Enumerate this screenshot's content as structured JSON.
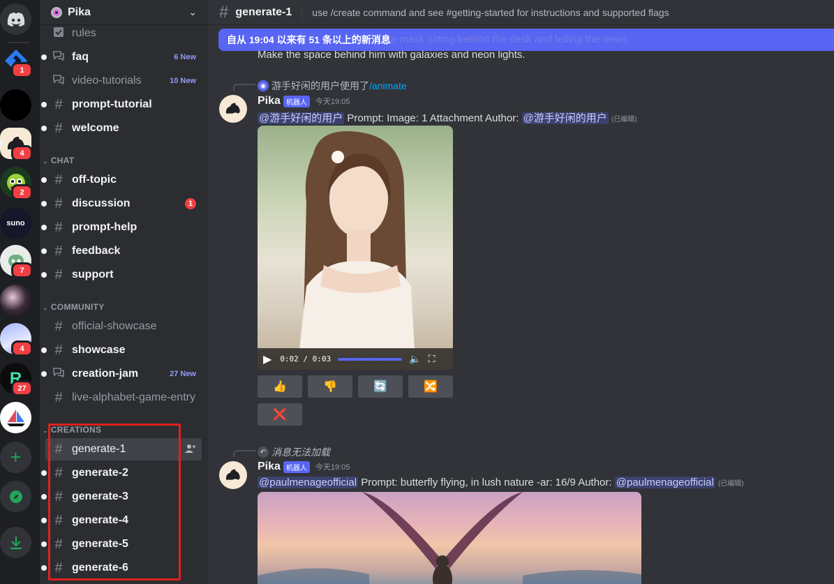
{
  "rail": {
    "servers": [
      {
        "name": "discord-home",
        "badge": ""
      },
      {
        "name": "server-blue",
        "badge": "1"
      },
      {
        "name": "server-black",
        "badge": ""
      },
      {
        "name": "server-pika",
        "badge": "4"
      },
      {
        "name": "server-green",
        "badge": "2"
      },
      {
        "name": "server-suno",
        "label": "suno",
        "badge": ""
      },
      {
        "name": "server-robot",
        "badge": "7"
      },
      {
        "name": "server-flowers",
        "badge": ""
      },
      {
        "name": "server-anime",
        "badge": "4"
      },
      {
        "name": "server-r",
        "badge": "27"
      },
      {
        "name": "server-sail",
        "badge": ""
      }
    ],
    "add_label": "+",
    "discover_label": "⌖",
    "download_label": "⭳"
  },
  "sidebar": {
    "guild_name": "Pika",
    "channels_top": [
      {
        "name": "rules",
        "icon": "#",
        "new": ""
      },
      {
        "name": "faq",
        "icon": "forum",
        "new": "6 New"
      },
      {
        "name": "video-tutorials",
        "icon": "forum",
        "new": "10 New"
      },
      {
        "name": "prompt-tutorial",
        "icon": "#",
        "new": ""
      },
      {
        "name": "welcome",
        "icon": "#",
        "new": ""
      }
    ],
    "cat_chat": "CHAT",
    "channels_chat": [
      {
        "name": "off-topic"
      },
      {
        "name": "discussion",
        "mention": "1"
      },
      {
        "name": "prompt-help"
      },
      {
        "name": "feedback"
      },
      {
        "name": "support"
      }
    ],
    "cat_community": "COMMUNITY",
    "channels_community": [
      {
        "name": "official-showcase"
      },
      {
        "name": "showcase"
      },
      {
        "name": "creation-jam",
        "new": "27 New"
      },
      {
        "name": "live-alphabet-game-entry"
      }
    ],
    "cat_creations": "CREATIONS",
    "channels_creations": [
      {
        "name": "generate-1"
      },
      {
        "name": "generate-2"
      },
      {
        "name": "generate-3"
      },
      {
        "name": "generate-4"
      },
      {
        "name": "generate-5"
      },
      {
        "name": "generate-6"
      }
    ]
  },
  "header": {
    "hash": "#",
    "channel": "generate-1",
    "topic": "use /create command and see #getting-started for instructions and supported flags"
  },
  "new_messages_bar": "自从 19:04 以来有 51 条以上的新消息",
  "ghost_text": "a mask sitting behind the desk and telling the news.",
  "prev_line": "Make the space behind him with galaxies and neon lights.",
  "msg1": {
    "reply_user": "游手好闲的用户使用了",
    "reply_cmd": "/animate",
    "author": "Pika",
    "bot_tag": "机器人",
    "time": "今天19:05",
    "mention1": "@游手好闲的用户",
    "text1": " Prompt:   Image: 1 Attachment  Author: ",
    "mention2": "@游手好闲的用户",
    "edited": "(已编辑)",
    "video_time": "0:02 / 0:03",
    "buttons": [
      "👍",
      "👎",
      "🔄",
      "🔀"
    ],
    "close": "❌"
  },
  "msg2": {
    "reply_text": "消息无法加载",
    "author": "Pika",
    "bot_tag": "机器人",
    "time": "今天19:05",
    "mention1": "@paulmenageofficial",
    "text1": " Prompt: butterfly flying, in lush nature  -ar: 16/9  Author: ",
    "mention2": "@paulmenageofficial",
    "edited": "(已编辑)"
  },
  "colors": {
    "accent": "#5865f2",
    "danger": "#f23f43",
    "highlight": "#e0211b"
  }
}
